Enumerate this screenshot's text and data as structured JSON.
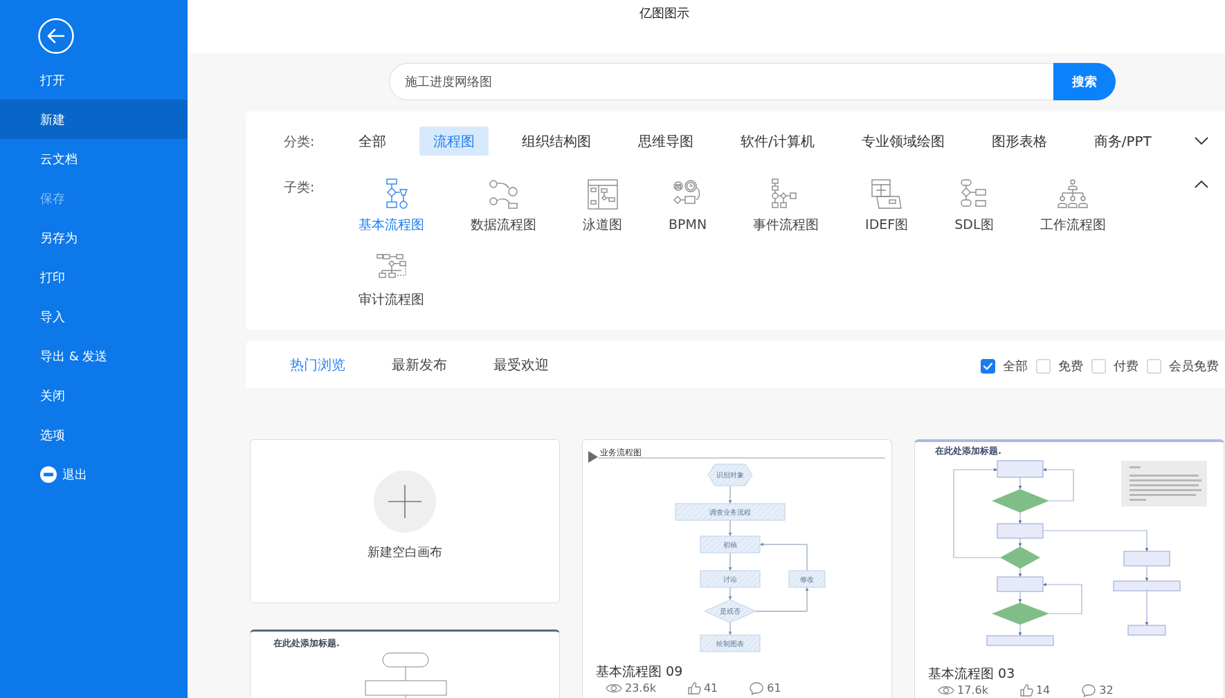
{
  "window": {
    "title": "亿图图示"
  },
  "sidebar": {
    "items": [
      {
        "label": "打开",
        "kind": "item",
        "selected": false,
        "disabled": false
      },
      {
        "label": "新建",
        "kind": "item",
        "selected": true,
        "disabled": false
      },
      {
        "label": "云文档",
        "kind": "item",
        "selected": false,
        "disabled": false
      },
      {
        "label": "保存",
        "kind": "item",
        "selected": false,
        "disabled": true
      },
      {
        "label": "另存为",
        "kind": "item",
        "selected": false,
        "disabled": false
      },
      {
        "label": "打印",
        "kind": "item",
        "selected": false,
        "disabled": false
      },
      {
        "label": "导入",
        "kind": "item",
        "selected": false,
        "disabled": false
      },
      {
        "label": "导出 & 发送",
        "kind": "item",
        "selected": false,
        "disabled": false
      },
      {
        "label": "关闭",
        "kind": "item",
        "selected": false,
        "disabled": false
      },
      {
        "label": "选项",
        "kind": "item",
        "selected": false,
        "disabled": false
      },
      {
        "label": "退出",
        "kind": "exit",
        "selected": false,
        "disabled": false
      }
    ]
  },
  "search": {
    "value": "施工进度网络图",
    "button": "搜索"
  },
  "categories": {
    "label": "分类:",
    "expanded": false,
    "items": [
      {
        "label": "全部",
        "selected": false
      },
      {
        "label": "流程图",
        "selected": true
      },
      {
        "label": "组织结构图",
        "selected": false
      },
      {
        "label": "思维导图",
        "selected": false
      },
      {
        "label": "软件/计算机",
        "selected": false
      },
      {
        "label": "专业领域绘图",
        "selected": false
      },
      {
        "label": "图形表格",
        "selected": false
      },
      {
        "label": "商务/PPT",
        "selected": false
      }
    ]
  },
  "subcategories": {
    "label": "子类:",
    "expanded": true,
    "items": [
      {
        "label": "基本流程图",
        "selected": true
      },
      {
        "label": "数据流程图",
        "selected": false
      },
      {
        "label": "泳道图",
        "selected": false
      },
      {
        "label": "BPMN",
        "selected": false
      },
      {
        "label": "事件流程图",
        "selected": false
      },
      {
        "label": "IDEF图",
        "selected": false
      },
      {
        "label": "SDL图",
        "selected": false
      },
      {
        "label": "工作流程图",
        "selected": false
      },
      {
        "label": "审计流程图",
        "selected": false
      }
    ]
  },
  "tabs": [
    {
      "label": "热门浏览",
      "selected": true
    },
    {
      "label": "最新发布",
      "selected": false
    },
    {
      "label": "最受欢迎",
      "selected": false
    }
  ],
  "filters": [
    {
      "label": "全部",
      "checked": true
    },
    {
      "label": "免费",
      "checked": false
    },
    {
      "label": "付费",
      "checked": false
    },
    {
      "label": "会员免费",
      "checked": false
    }
  ],
  "new_canvas": {
    "label": "新建空白画布"
  },
  "templates": [
    {
      "title": "基本流程图 09",
      "views": "23.6k",
      "likes": "41",
      "comments": "61",
      "preview": {
        "kind": "business",
        "heading": "业务流程图",
        "nodes": [
          "识别对象",
          "调查业务流程",
          "初稿",
          "讨论",
          "修改",
          "是或否",
          "绘制图表"
        ]
      }
    },
    {
      "title": "基本流程图 03",
      "views": "17.6k",
      "likes": "14",
      "comments": "32",
      "preview": {
        "kind": "approval",
        "heading": "在此处添加标题."
      }
    },
    {
      "preview": {
        "kind": "outline",
        "heading": "在此处添加标题."
      }
    }
  ]
}
